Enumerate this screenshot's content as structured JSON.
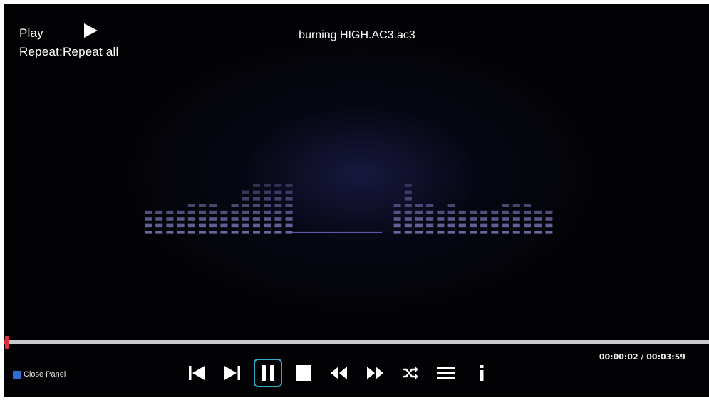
{
  "player": {
    "state_label": "Play",
    "repeat_label": "Repeat:Repeat all",
    "track_title": "burning HIGH.AC3.ac3",
    "time_display": "00:00:02 / 00:03:59",
    "progress_fraction": 0.003
  },
  "panel": {
    "close_label": "Close Panel"
  },
  "controls": [
    {
      "name": "previous-button",
      "icon": "skip-previous-icon"
    },
    {
      "name": "next-button",
      "icon": "skip-next-icon"
    },
    {
      "name": "pause-button",
      "icon": "pause-icon"
    },
    {
      "name": "stop-button",
      "icon": "stop-icon"
    },
    {
      "name": "rewind-button",
      "icon": "rewind-icon"
    },
    {
      "name": "fast-forward-button",
      "icon": "fast-forward-icon"
    },
    {
      "name": "shuffle-button",
      "icon": "shuffle-icon"
    },
    {
      "name": "playlist-button",
      "icon": "list-icon"
    },
    {
      "name": "info-button",
      "icon": "info-icon"
    }
  ],
  "colors": {
    "progress": "#e0303a",
    "track": "#c9c9cc",
    "focus_ring": "#3aa7c4",
    "close_panel_key": "#2a6fd6",
    "equalizer": "#7a7ab8"
  },
  "equalizer_levels": [
    4,
    4,
    4,
    4,
    5,
    5,
    5,
    4,
    5,
    7,
    8,
    8,
    8,
    8,
    0,
    0,
    0,
    0,
    0,
    0,
    0,
    0,
    0,
    5,
    8,
    5,
    5,
    4,
    5,
    4,
    4,
    4,
    4,
    5,
    5,
    5,
    4,
    4
  ]
}
